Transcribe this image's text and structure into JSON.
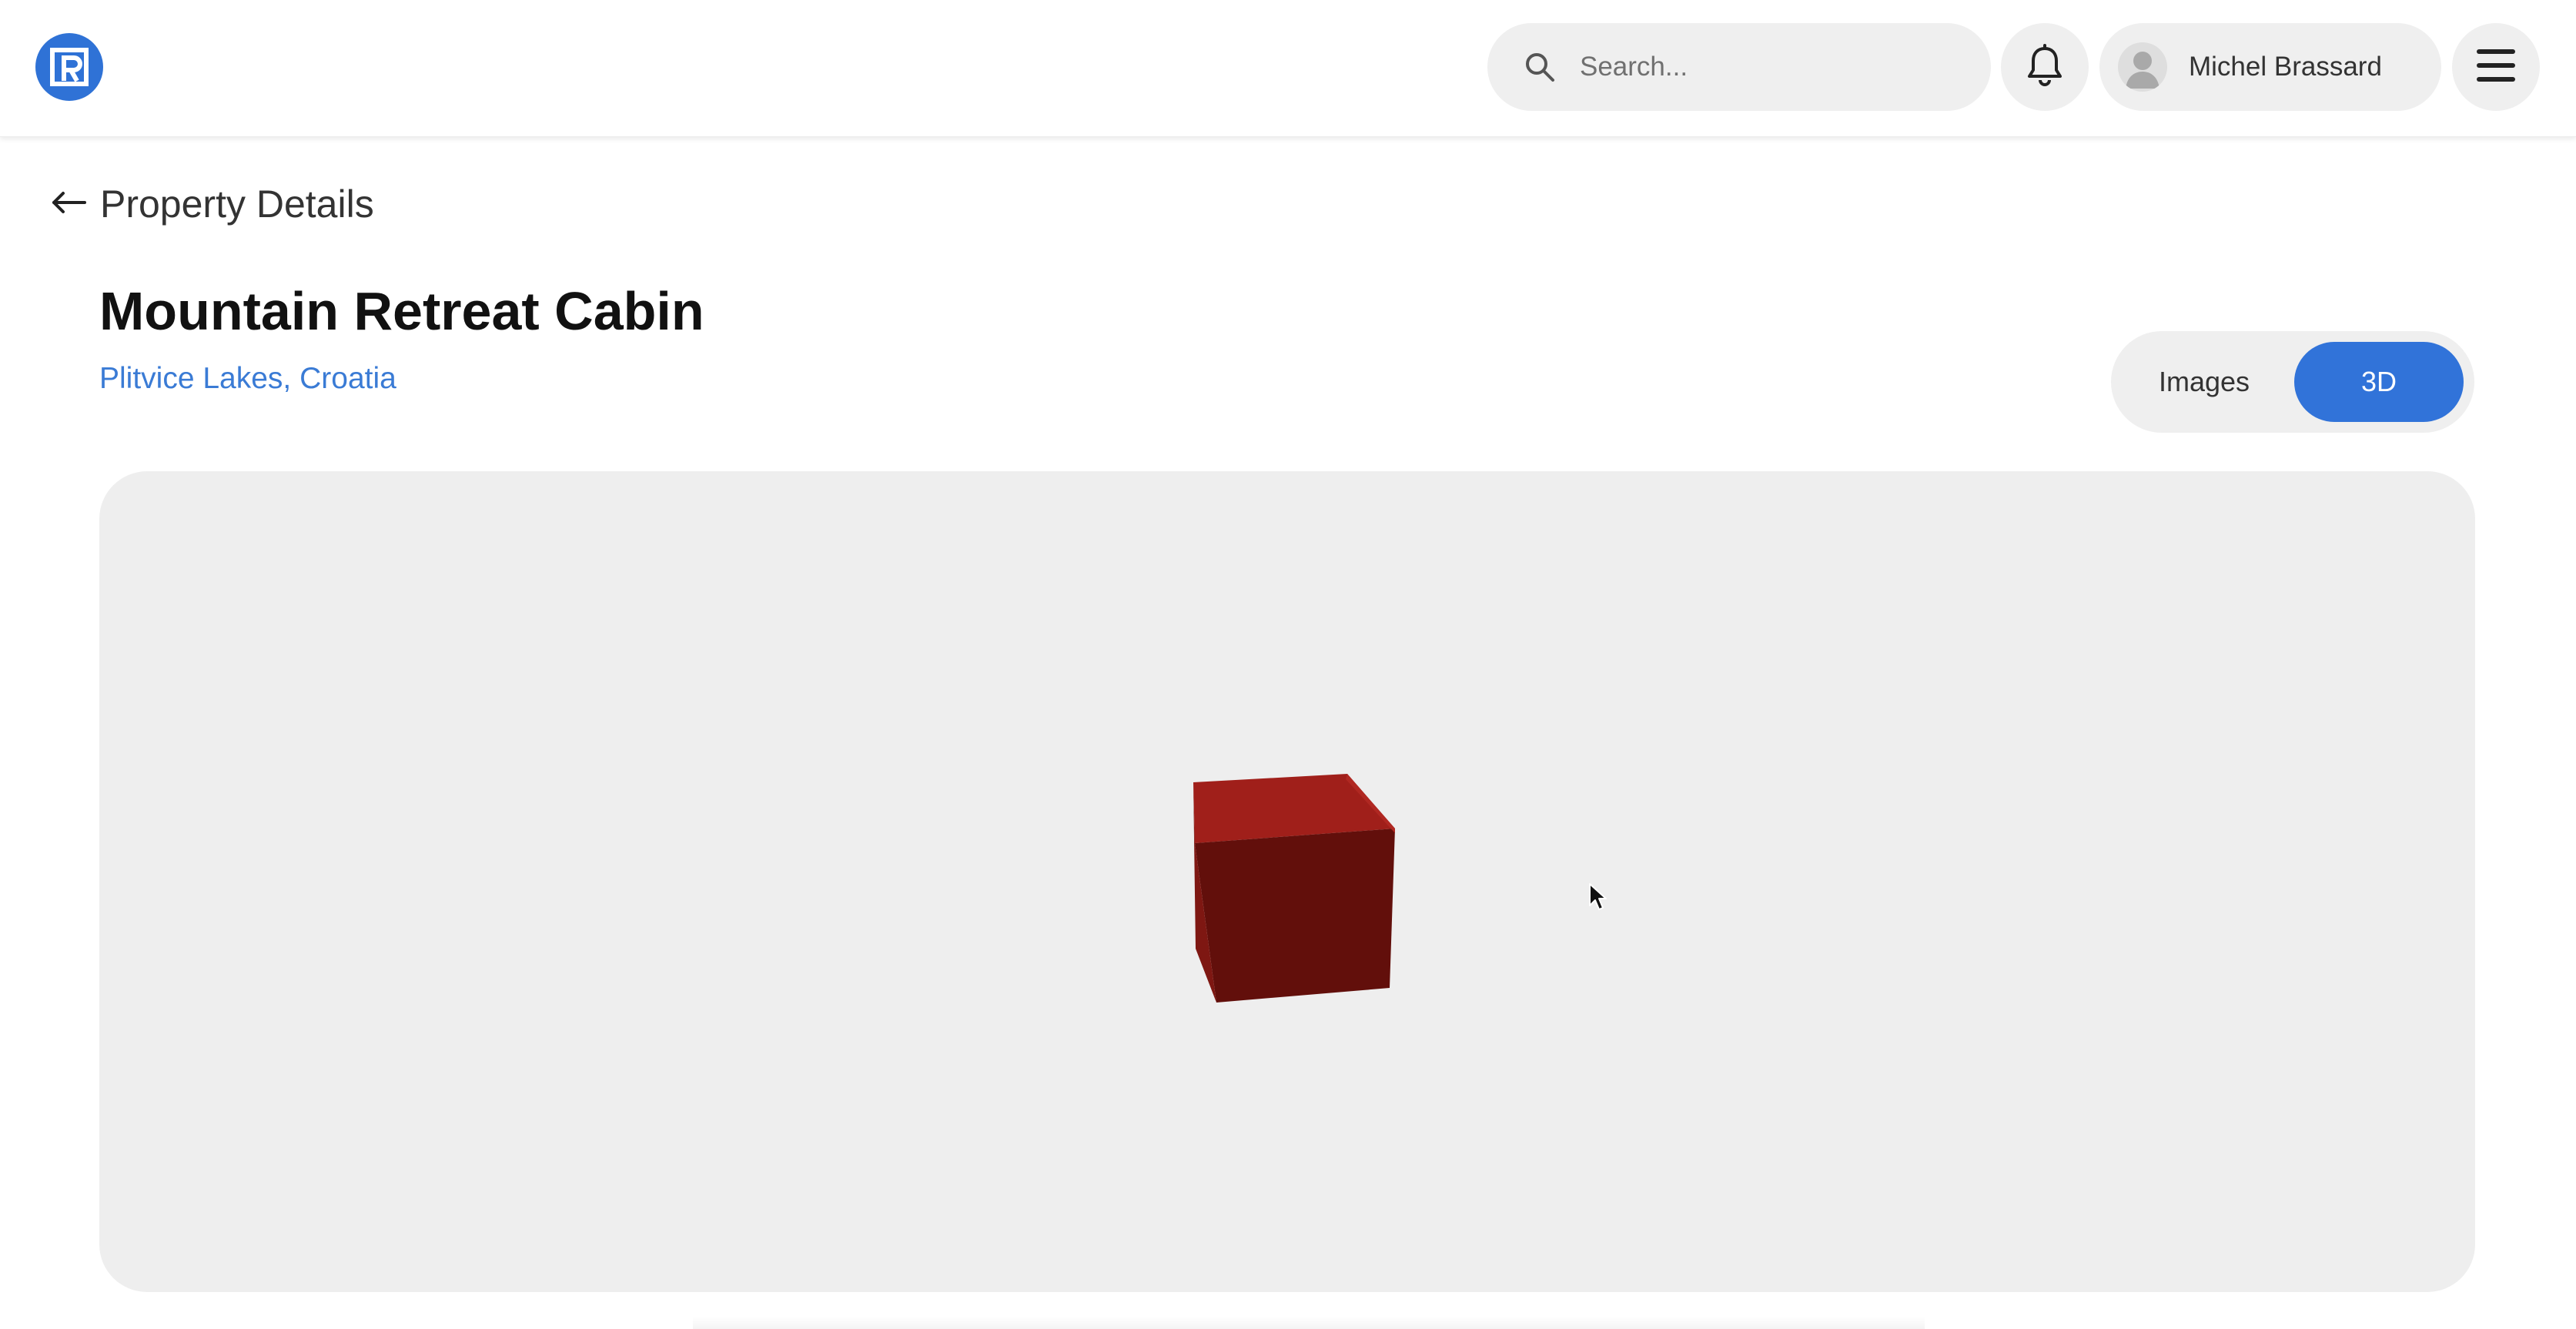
{
  "header": {
    "logo_icon": "r-logo-icon",
    "brand_color": "#2f72d6",
    "search": {
      "placeholder": "Search...",
      "value": "",
      "icon": "search-icon"
    },
    "notifications_icon": "bell-icon",
    "user": {
      "name": "Michel Brassard",
      "avatar_icon": "user-avatar-icon"
    },
    "menu_icon": "hamburger-menu-icon"
  },
  "page": {
    "back_icon": "arrow-left-icon",
    "back_label": "Property Details",
    "title": "Mountain Retreat Cabin",
    "location": "Plitvice Lakes, Croatia",
    "location_color": "#3a7bd5"
  },
  "view_toggle": {
    "options": [
      "Images",
      "3D"
    ],
    "selected": "3D",
    "active_color": "#3173d9"
  },
  "viewer": {
    "background": "#eeeeee",
    "model": "cube",
    "model_colors": {
      "top": "#a01f1a",
      "front": "#620f0b",
      "side": "#7e1712"
    }
  }
}
